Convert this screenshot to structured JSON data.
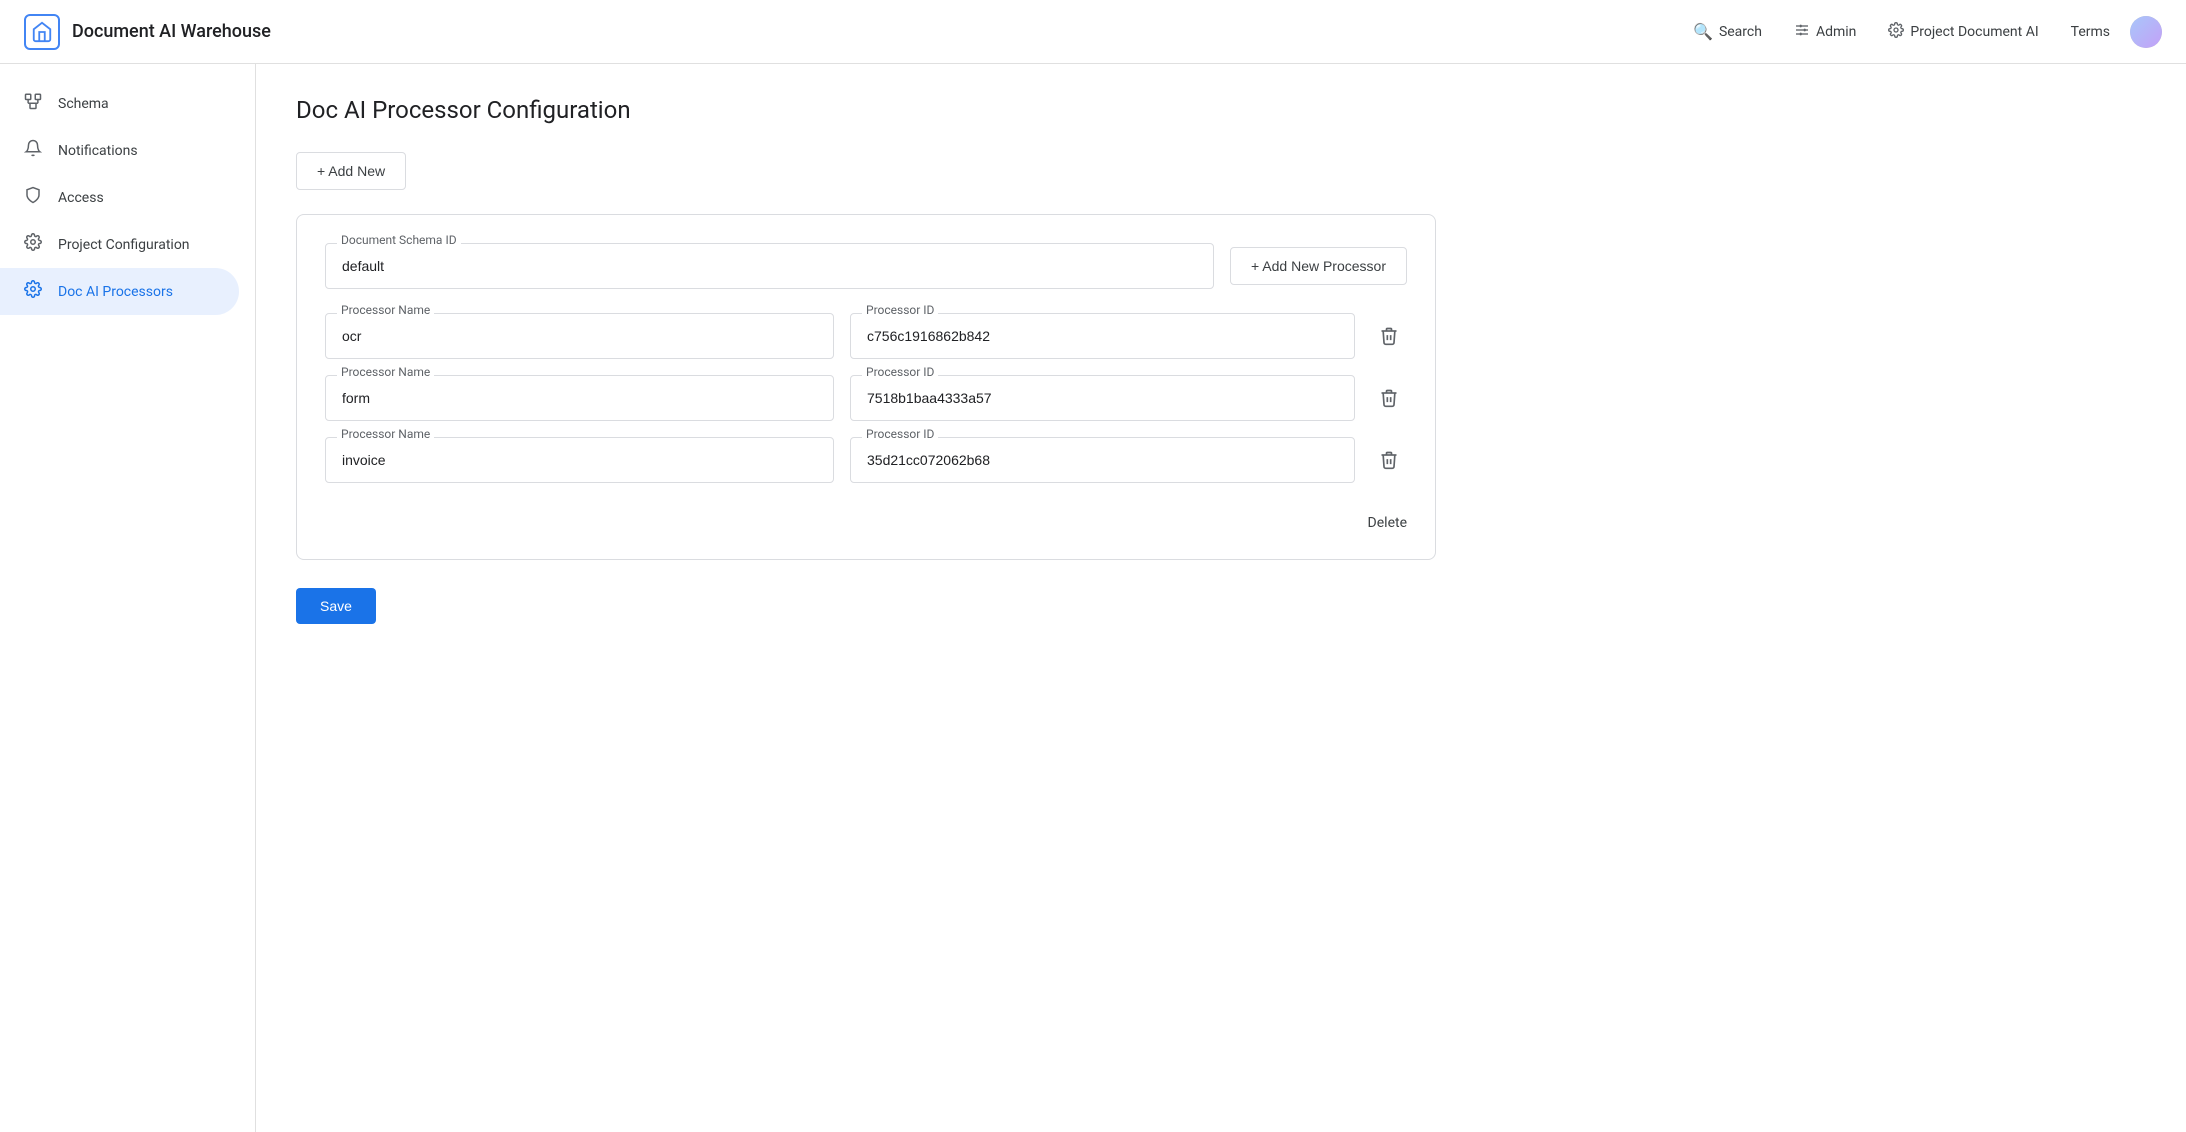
{
  "header": {
    "logo_text": "🏠",
    "title": "Document AI Warehouse",
    "nav": [
      {
        "id": "search",
        "icon": "🔍",
        "label": "Search"
      },
      {
        "id": "admin",
        "icon": "⚙",
        "label": "Admin"
      },
      {
        "id": "project",
        "icon": "⚙",
        "label": "Project Document AI"
      },
      {
        "id": "terms",
        "icon": "",
        "label": "Terms"
      }
    ]
  },
  "sidebar": {
    "items": [
      {
        "id": "schema",
        "icon": "schema",
        "label": "Schema"
      },
      {
        "id": "notifications",
        "icon": "bell",
        "label": "Notifications"
      },
      {
        "id": "access",
        "icon": "access",
        "label": "Access"
      },
      {
        "id": "project-configuration",
        "icon": "gear",
        "label": "Project Configuration"
      },
      {
        "id": "doc-ai-processors",
        "icon": "gear-blue",
        "label": "Doc AI Processors"
      }
    ]
  },
  "page": {
    "title": "Doc AI Processor Configuration",
    "add_new_label": "+ Add New",
    "add_new_processor_label": "+ Add New Processor",
    "save_label": "Save",
    "delete_label": "Delete",
    "document_schema_id_label": "Document Schema ID",
    "document_schema_id_value": "default",
    "processors": [
      {
        "name_label": "Processor Name",
        "name_value": "ocr",
        "id_label": "Processor ID",
        "id_value": "c756c1916862b842"
      },
      {
        "name_label": "Processor Name",
        "name_value": "form",
        "id_label": "Processor ID",
        "id_value": "7518b1baa4333a57"
      },
      {
        "name_label": "Processor Name",
        "name_value": "invoice",
        "id_label": "Processor ID",
        "id_value": "35d21cc072062b68"
      }
    ]
  }
}
